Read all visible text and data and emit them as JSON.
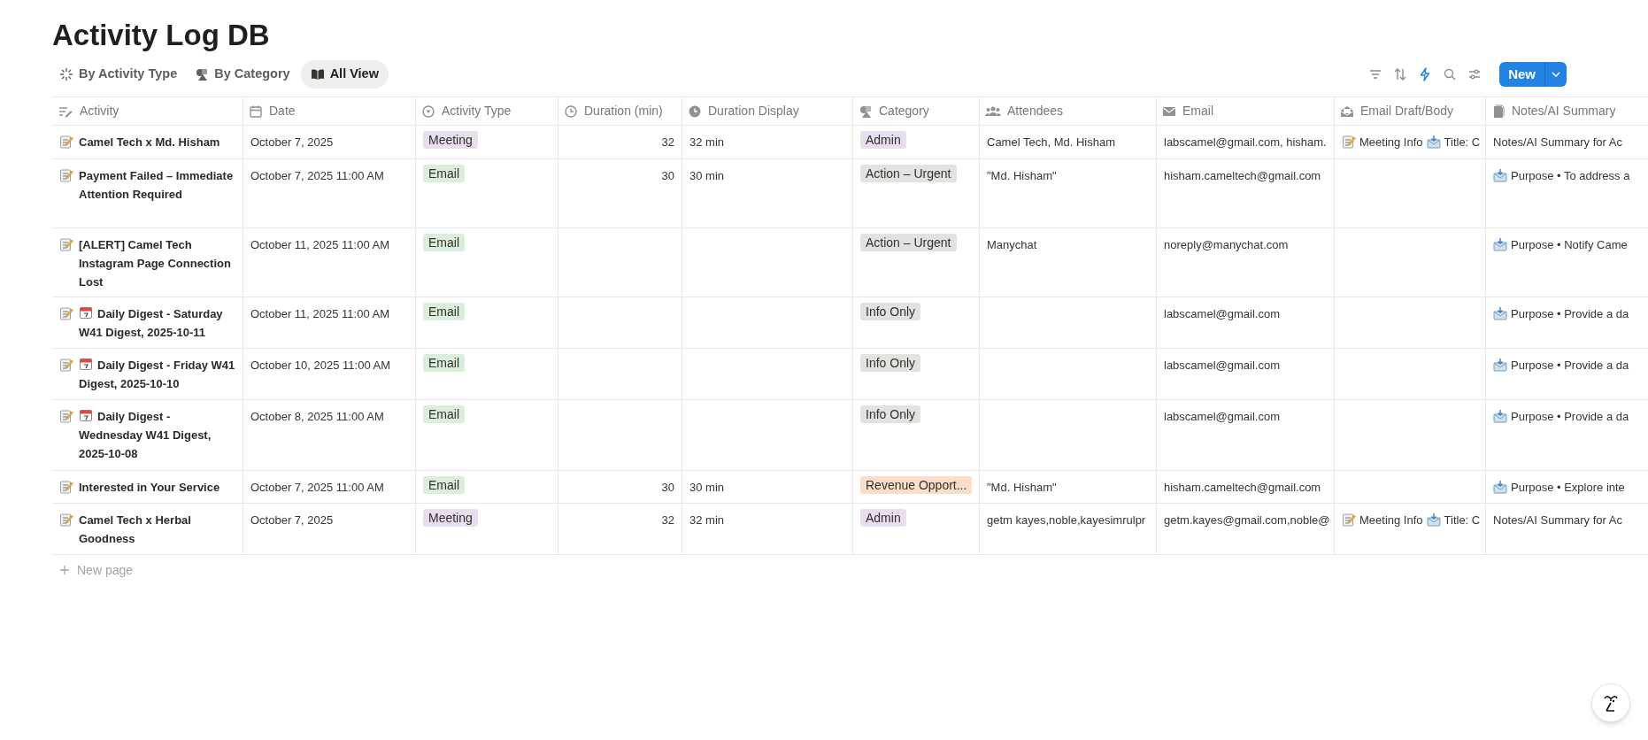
{
  "title": "Activity Log DB",
  "views": [
    {
      "label": "By Activity Type",
      "kind": "sparkle",
      "selected": false
    },
    {
      "label": "By Category",
      "kind": "shapes",
      "selected": false
    },
    {
      "label": "All View",
      "kind": "book",
      "selected": true
    }
  ],
  "toolbar": {
    "new_button": "New"
  },
  "table": {
    "columns": [
      {
        "label": "Activity",
        "kind": "title"
      },
      {
        "label": "Date",
        "kind": "date"
      },
      {
        "label": "Activity Type",
        "kind": "select"
      },
      {
        "label": "Duration (min)",
        "kind": "number"
      },
      {
        "label": "Duration Display",
        "kind": "formula"
      },
      {
        "label": "Category",
        "kind": "shapes"
      },
      {
        "label": "Attendees",
        "kind": "people"
      },
      {
        "label": "Email",
        "kind": "email"
      },
      {
        "label": "Email Draft/Body",
        "kind": "draft"
      },
      {
        "label": "Notes/AI Summary",
        "kind": "notes"
      }
    ],
    "rows": [
      {
        "activity": "Camel Tech x Md. Hisham",
        "calendar": false,
        "date": "October 7, 2025",
        "activity_type": {
          "label": "Meeting",
          "color": "#e8deee"
        },
        "duration_min": "32",
        "duration_display": "32 min",
        "category": {
          "label": "Admin",
          "color": "#e8deee"
        },
        "attendees": "Camel Tech, Md. Hisham",
        "email": "labscamel@gmail.com, hisham.",
        "email_draft": [
          {
            "kind": "memo",
            "text": "Meeting Info"
          },
          {
            "kind": "envelope",
            "text": "Title: C"
          }
        ],
        "notes": {
          "kind": "plain",
          "text": "Notes/AI Summary for Ac"
        }
      },
      {
        "activity": "Payment Failed – Immediate Attention Required",
        "calendar": false,
        "date": "October 7, 2025 11:00 AM",
        "activity_type": {
          "label": "Email",
          "color": "#dbeddb"
        },
        "duration_min": "30",
        "duration_display": "30 min",
        "category": {
          "label": "Action – Urgent",
          "color": "#e3e2e0"
        },
        "attendees": "\"Md. Hisham\"",
        "email": "hisham.cameltech@gmail.com",
        "email_draft": [],
        "notes": {
          "kind": "envelope",
          "text": "Purpose • To address a"
        }
      },
      {
        "activity": "[ALERT] Camel Tech Instagram Page Connection Lost",
        "calendar": false,
        "date": "October 11, 2025 11:00 AM",
        "activity_type": {
          "label": "Email",
          "color": "#dbeddb"
        },
        "category": {
          "label": "Action – Urgent",
          "color": "#e3e2e0"
        },
        "attendees": "Manychat",
        "email": "noreply@manychat.com",
        "email_draft": [],
        "notes": {
          "kind": "envelope",
          "text": "Purpose • Notify Came"
        }
      },
      {
        "activity": "Daily Digest - Saturday W41 Digest, 2025-10-11",
        "calendar": true,
        "date": "October 11, 2025 11:00 AM",
        "activity_type": {
          "label": "Email",
          "color": "#dbeddb"
        },
        "category": {
          "label": "Info Only",
          "color": "#e3e2e0"
        },
        "email": "labscamel@gmail.com",
        "email_draft": [],
        "notes": {
          "kind": "envelope",
          "text": "Purpose • Provide a da"
        }
      },
      {
        "activity": "Daily Digest - Friday W41 Digest, 2025-10-10",
        "calendar": true,
        "date": "October 10, 2025 11:00 AM",
        "activity_type": {
          "label": "Email",
          "color": "#dbeddb"
        },
        "category": {
          "label": "Info Only",
          "color": "#e3e2e0"
        },
        "email": "labscamel@gmail.com",
        "email_draft": [],
        "notes": {
          "kind": "envelope",
          "text": "Purpose • Provide a da"
        }
      },
      {
        "activity": "Daily Digest - Wednesday W41 Digest, 2025-10-08",
        "calendar": true,
        "date": "October 8, 2025 11:00 AM",
        "activity_type": {
          "label": "Email",
          "color": "#dbeddb"
        },
        "category": {
          "label": "Info Only",
          "color": "#e3e2e0"
        },
        "email": "labscamel@gmail.com",
        "email_draft": [],
        "notes": {
          "kind": "envelope",
          "text": "Purpose • Provide a da"
        }
      },
      {
        "activity": "Interested in Your Service",
        "calendar": false,
        "date": "October 7, 2025 11:00 AM",
        "activity_type": {
          "label": "Email",
          "color": "#dbeddb"
        },
        "duration_min": "30",
        "duration_display": "30 min",
        "category": {
          "label": "Revenue Opport...",
          "color": "#fadec9"
        },
        "attendees": "\"Md. Hisham\"",
        "email": "hisham.cameltech@gmail.com",
        "email_draft": [],
        "notes": {
          "kind": "envelope",
          "text": "Purpose • Explore inte"
        }
      },
      {
        "activity": "Camel Tech x Herbal Goodness",
        "calendar": false,
        "date": "October 7, 2025",
        "activity_type": {
          "label": "Meeting",
          "color": "#e8deee"
        },
        "duration_min": "32",
        "duration_display": "32 min",
        "category": {
          "label": "Admin",
          "color": "#e8deee"
        },
        "attendees": "getm kayes,noble,kayesimrulpr",
        "email": "getm.kayes@gmail.com,noble@",
        "email_draft": [
          {
            "kind": "memo",
            "text": "Meeting Info"
          },
          {
            "kind": "envelope",
            "text": "Title: C"
          }
        ],
        "notes": {
          "kind": "plain",
          "text": "Notes/AI Summary for Ac"
        }
      }
    ],
    "new_row": "New page"
  }
}
